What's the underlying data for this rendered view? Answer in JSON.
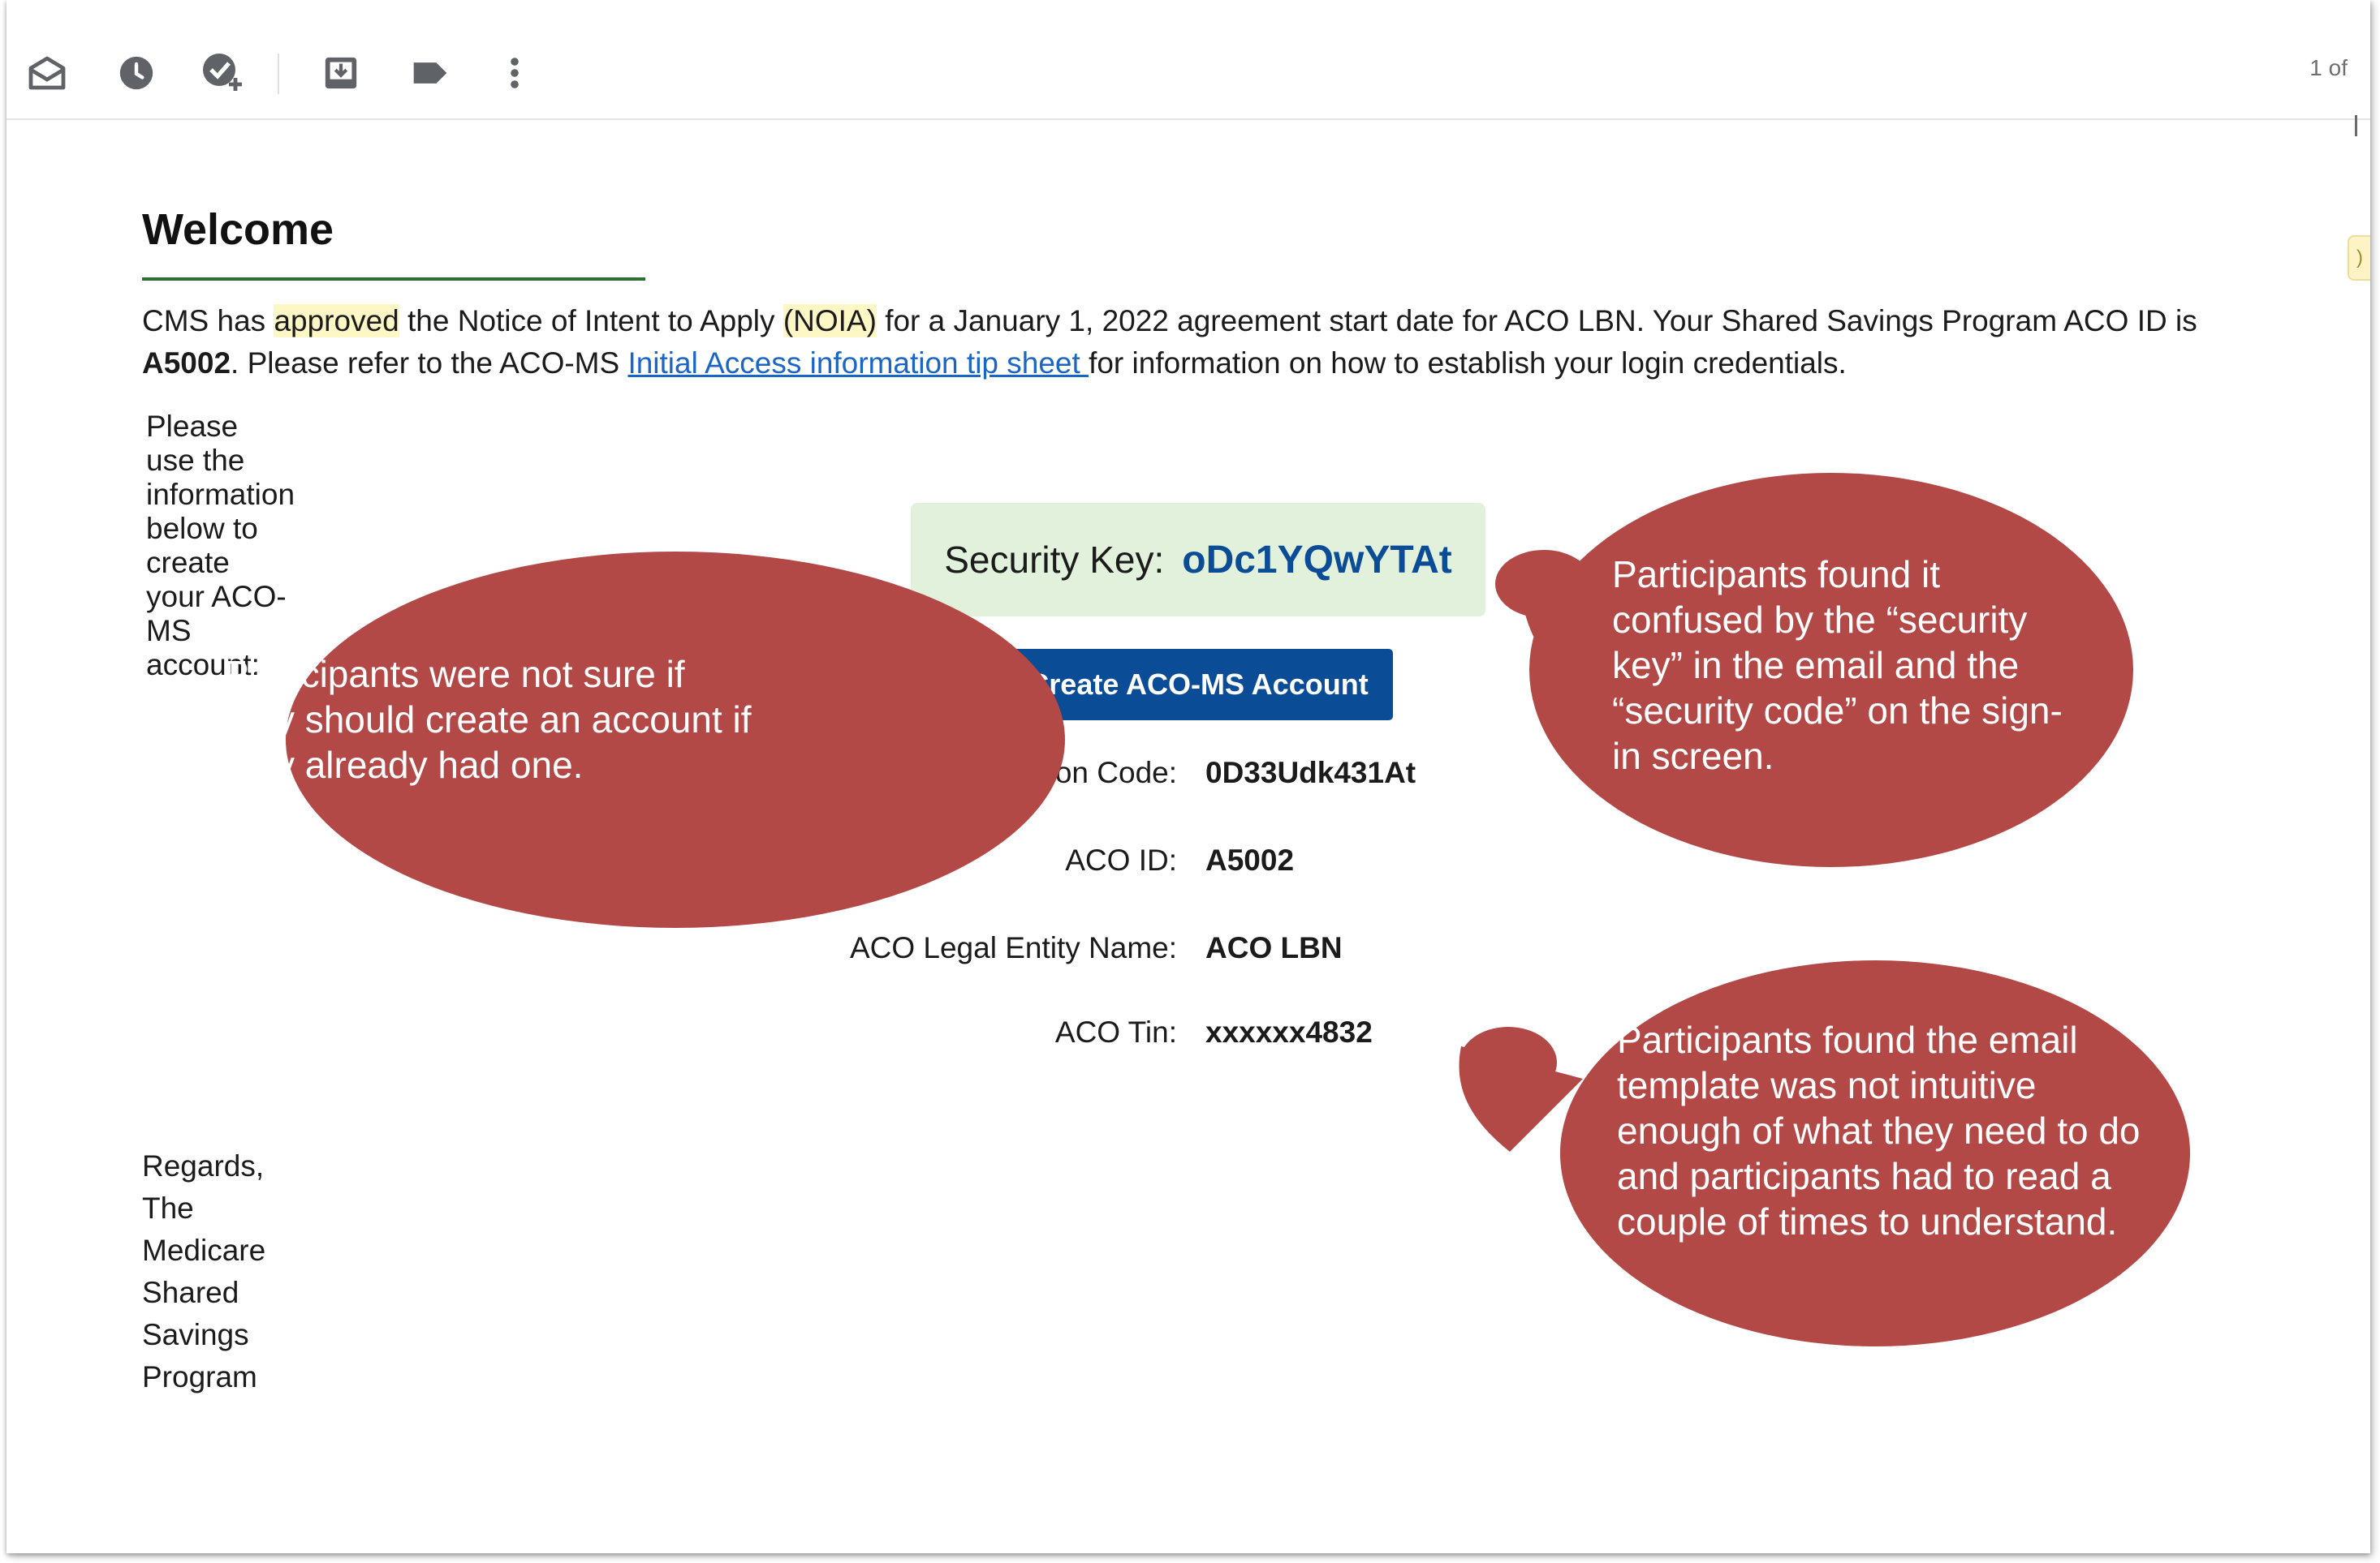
{
  "toolbar": {
    "pager": "1 of",
    "icons": [
      "mark-as-read-icon",
      "snooze-icon",
      "add-to-tasks-icon",
      "move-to-inbox-icon",
      "label-icon",
      "more-icon"
    ]
  },
  "side_badge": ")",
  "email": {
    "heading": "Welcome",
    "p1_a": "CMS has ",
    "p1_hl1": "approved",
    "p1_b": " the Notice of Intent to Apply ",
    "p1_hl2": "(NOIA)",
    "p1_c": " for a January 1, 2022 agreement start date for ACO LBN. Your Shared Savings Program ACO ID is ",
    "p1_id": "A5002",
    "p1_d": ". Please refer to the ACO-MS ",
    "p1_link": "Initial Access information tip sheet ",
    "p1_e": "for information on how to establish your login credentials.",
    "p2": "Please use the information below to create your ACO-MS account:",
    "security_key_label": "Security Key:",
    "security_key_value": "oDc1YQwYTAt",
    "create_button": "Create ACO-MS Account",
    "fields": [
      {
        "label": "Confirmation Code:",
        "value": "0D33Udk431At"
      },
      {
        "label": "ACO ID:",
        "value": "A5002"
      },
      {
        "label": "ACO Legal Entity Name:",
        "value": "ACO LBN"
      },
      {
        "label": "ACO Tin:",
        "value": "xxxxxx4832"
      }
    ],
    "regards": "Regards,",
    "signature": "The Medicare Shared Savings Program"
  },
  "annotations": {
    "color": "#b34947",
    "left": "Participants were not sure if they should create an account if they already had one.",
    "right_top": "Participants found it confused by the “security key” in the email and the “security code” on the sign-in screen.",
    "right_bottom": "Participants found the email template was not intuitive enough of what they need to do and participants had to read a couple of times to understand."
  }
}
